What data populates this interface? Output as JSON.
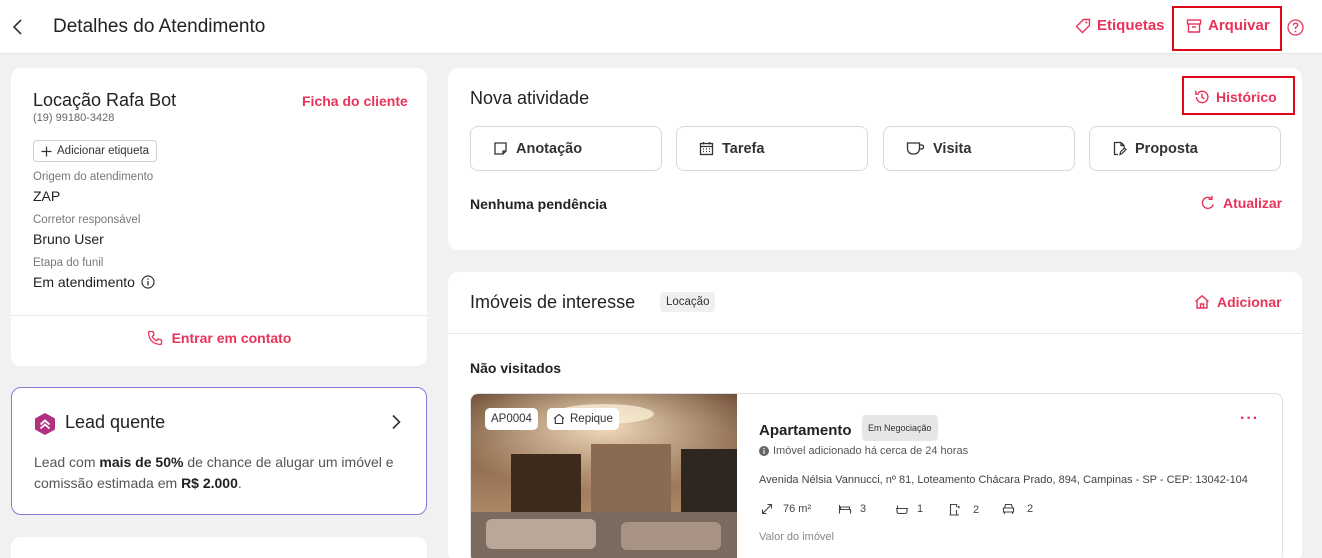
{
  "header": {
    "title": "Detalhes do Atendimento",
    "tags_label": "Etiquetas",
    "archive_label": "Arquivar"
  },
  "client": {
    "name": "Locação Rafa Bot",
    "phone": "(19) 99180-3428",
    "profile_link": "Ficha do cliente",
    "add_tag_label": "Adicionar etiqueta",
    "fields": [
      {
        "label": "Origem do atendimento",
        "value": "ZAP"
      },
      {
        "label": "Corretor responsável",
        "value": "Bruno User"
      },
      {
        "label": "Etapa do funil",
        "value": "Em atendimento"
      }
    ],
    "contact_label": "Entrar em contato"
  },
  "lead": {
    "title": "Lead quente",
    "text_1": "Lead com ",
    "text_bold_1": "mais de 50%",
    "text_2": " de chance de alugar um imóvel e comissão estimada em ",
    "text_bold_2": "R$ 2.000",
    "text_3": "."
  },
  "activity": {
    "title": "Nova atividade",
    "history_label": "Histórico",
    "buttons": [
      "Anotação",
      "Tarefa",
      "Visita",
      "Proposta"
    ],
    "pending_text": "Nenhuma pendência",
    "refresh_label": "Atualizar"
  },
  "properties": {
    "title": "Imóveis de interesse",
    "badge": "Locação",
    "add_label": "Adicionar",
    "subsection": "Não visitados",
    "item": {
      "code": "AP0004",
      "repique_label": "Repique",
      "type": "Apartamento",
      "status": "Em Negociação",
      "added_note": "Imóvel adicionado há cerca de 24 horas",
      "address": "Avenida Nélsia Vannucci, nº 81, Loteamento Chácara Prado, 894, Campinas - SP - CEP: 13042-104",
      "area": "76 m²",
      "bedrooms": "3",
      "bathrooms": "1",
      "suites": "2",
      "parking": "2",
      "value_label": "Valor do imóvel"
    }
  },
  "colors": {
    "accent": "#e8345a",
    "highlight_box": "#e0071b",
    "lead_border": "#8e78d6"
  }
}
